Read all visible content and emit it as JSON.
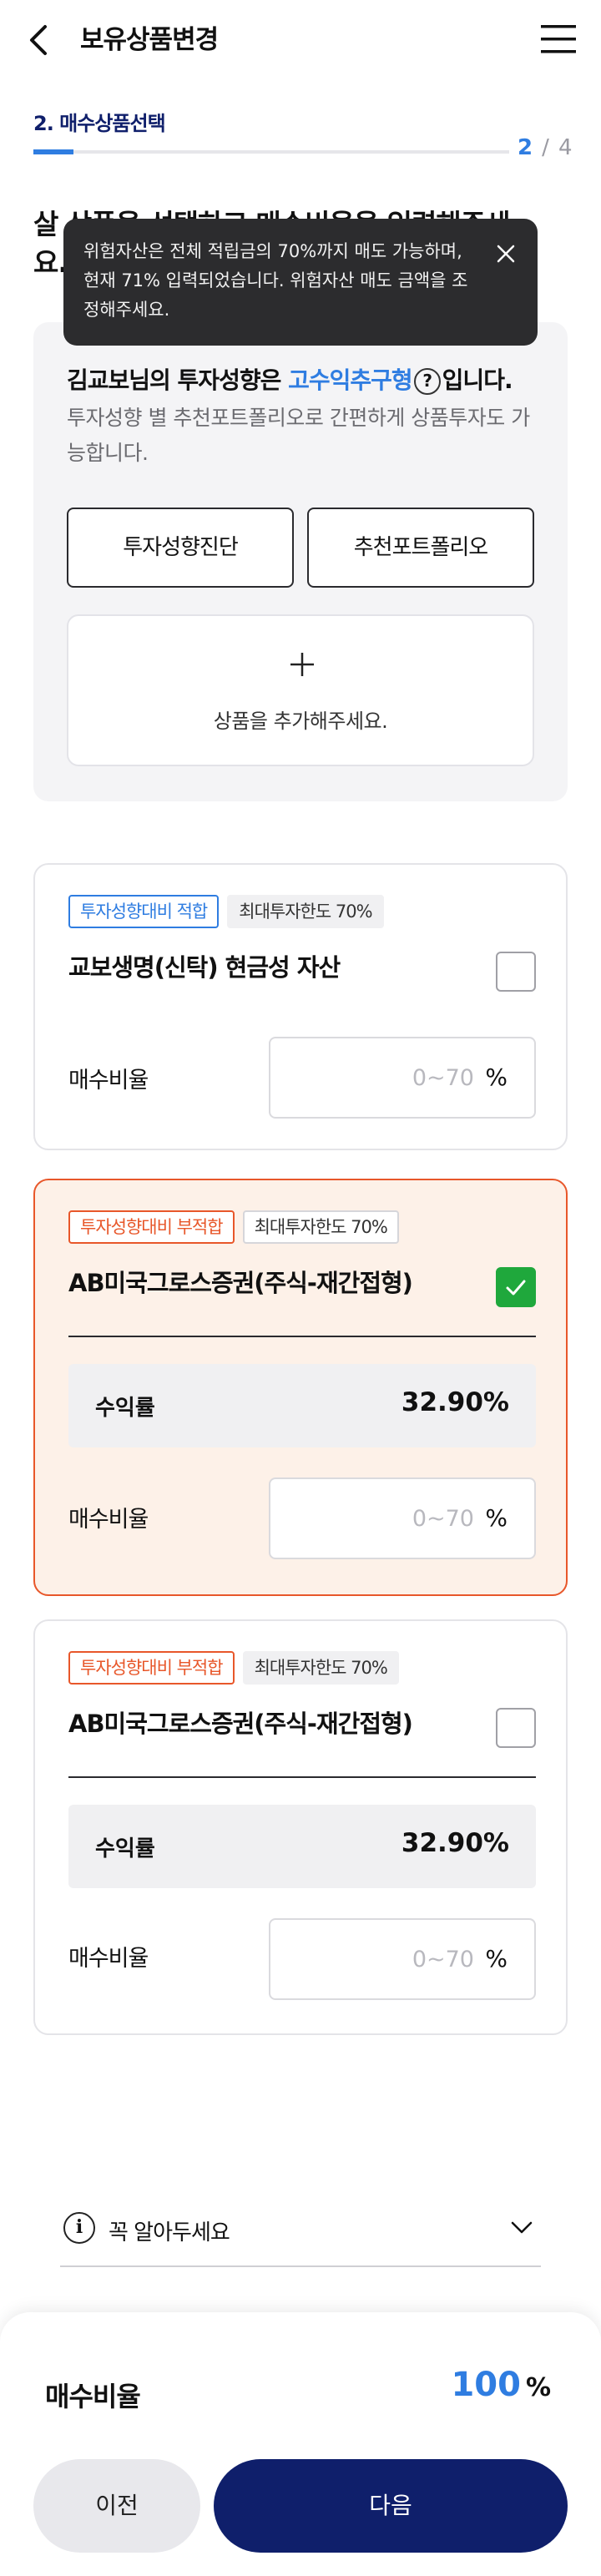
{
  "header": {
    "title": "보유상품변경",
    "back_icon": "chevron-left-icon",
    "menu_icon": "hamburger-menu-icon"
  },
  "progress": {
    "step_label": "2. 매수상품선택",
    "current": "2",
    "separator": "/",
    "total": "4",
    "fraction": 0.083
  },
  "page_title": "살 상품을 선택하고 매수비율을 입력해주세요.",
  "tooltip": {
    "text": "위험자산은 전체 적립금의 70%까지 매도 가능하며, 현재 71% 입력되었습니다. 위험자산 매도 금액을 조정해주세요.",
    "close_icon": "close-icon"
  },
  "profile": {
    "prefix": "김교보님의 투자성향은 ",
    "type": "고수익추구형",
    "help_symbol": "?",
    "suffix": "입니다.",
    "description": "투자성향 별 추천포트폴리오로 간편하게 상품투자도 가능합니다.",
    "diagnose_button": "투자성향진단",
    "recommend_button": "추천포트폴리오",
    "add_product_label": "상품을 추가해주세요.",
    "add_icon": "plus-icon"
  },
  "products": [
    {
      "badge_suitability": "투자성향대비 적합",
      "badge_limit": "최대투자한도 70%",
      "name": "교보생명(신탁) 현금성 자산",
      "checked": false,
      "ratio_label": "매수비율",
      "ratio_placeholder": "0~70",
      "ratio_unit": "%"
    },
    {
      "badge_suitability": "투자성향대비 부적합",
      "badge_limit": "최대투자한도 70%",
      "name": "AB미국그로스증권(주식-재간접형)",
      "checked": true,
      "yield_label": "수익률",
      "yield_value": "32.90%",
      "ratio_label": "매수비율",
      "ratio_placeholder": "0~70",
      "ratio_unit": "%"
    },
    {
      "badge_suitability": "투자성향대비 부적합",
      "badge_limit": "최대투자한도 70%",
      "name": "AB미국그로스증권(주식-재간접형)",
      "checked": false,
      "yield_label": "수익률",
      "yield_value": "32.90%",
      "ratio_label": "매수비율",
      "ratio_placeholder": "0~70",
      "ratio_unit": "%"
    }
  ],
  "notice": {
    "label": "꼭 알아두세요",
    "info_symbol": "i",
    "info_icon": "info-icon",
    "chevron_icon": "chevron-down-icon"
  },
  "footer": {
    "total_label": "매수비율",
    "total_value": "100",
    "total_unit": "%",
    "prev_button": "이전",
    "next_button": "다음"
  },
  "colors": {
    "accent_blue": "#2f7de1",
    "navy": "#0f1f6b",
    "warning_orange": "#e8572a",
    "check_green": "#1fa83c",
    "tooltip_bg": "#2c2c2e"
  }
}
